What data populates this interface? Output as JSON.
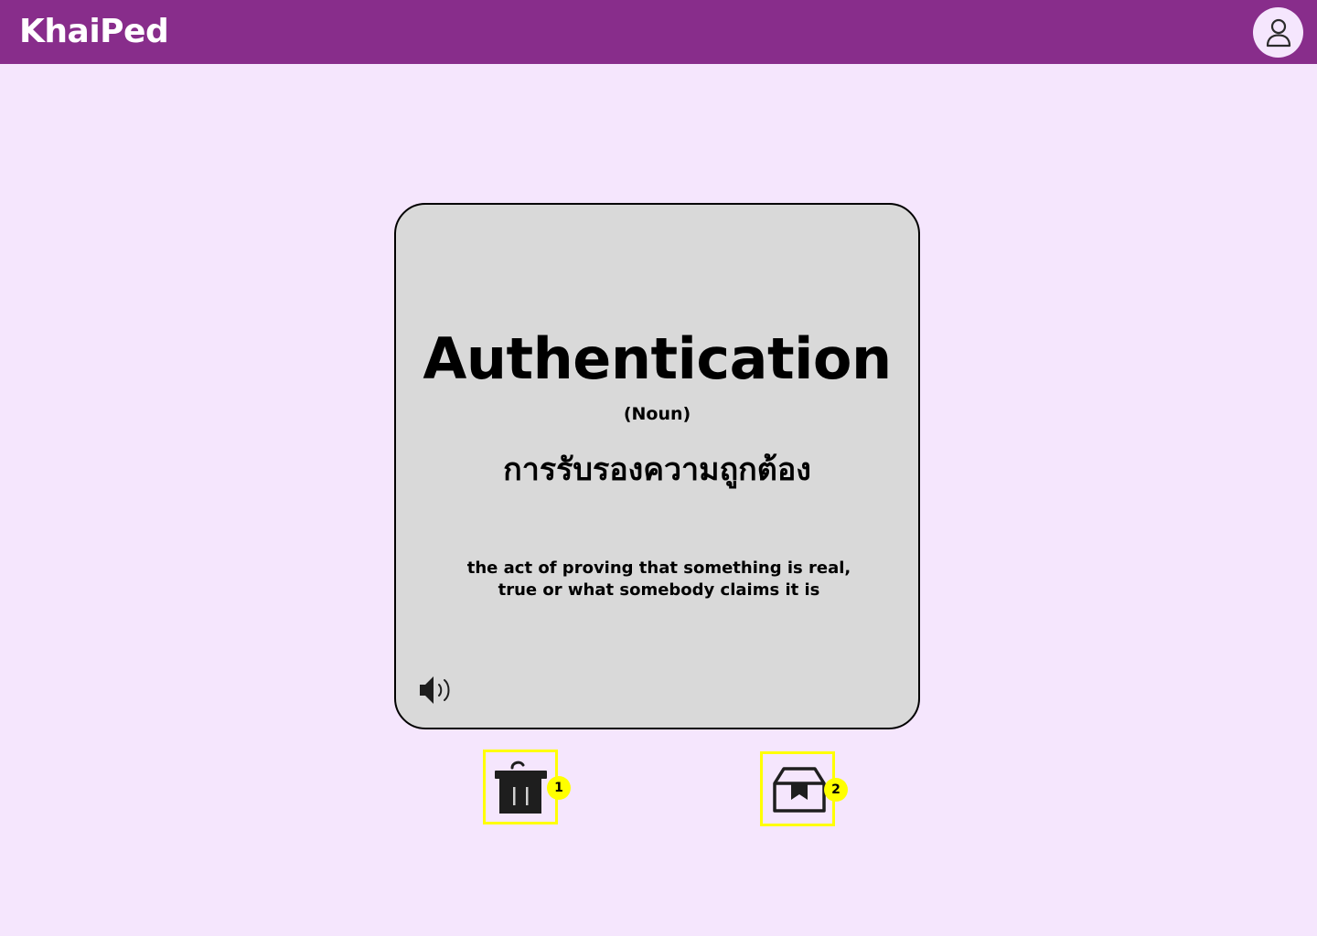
{
  "app": {
    "name": "KhaiPed",
    "brand_color": "#882d8b",
    "background_color": "#f5e6fd"
  },
  "header": {
    "logo_text": "KhaiPed",
    "profile_icon": "user-icon"
  },
  "flashcard": {
    "word": "Authentication",
    "part_of_speech": "(Noun)",
    "translation": "การรับรองความถูกต้อง",
    "definition": "the act of proving that something is real, true or what somebody claims it is",
    "audio_icon": "speaker-icon",
    "card_color": "#d9d9d9"
  },
  "actions": [
    {
      "icon": "trash-icon",
      "badge": "1"
    },
    {
      "icon": "archive-box-icon",
      "badge": "2"
    }
  ],
  "highlight_color": "#ffff00"
}
